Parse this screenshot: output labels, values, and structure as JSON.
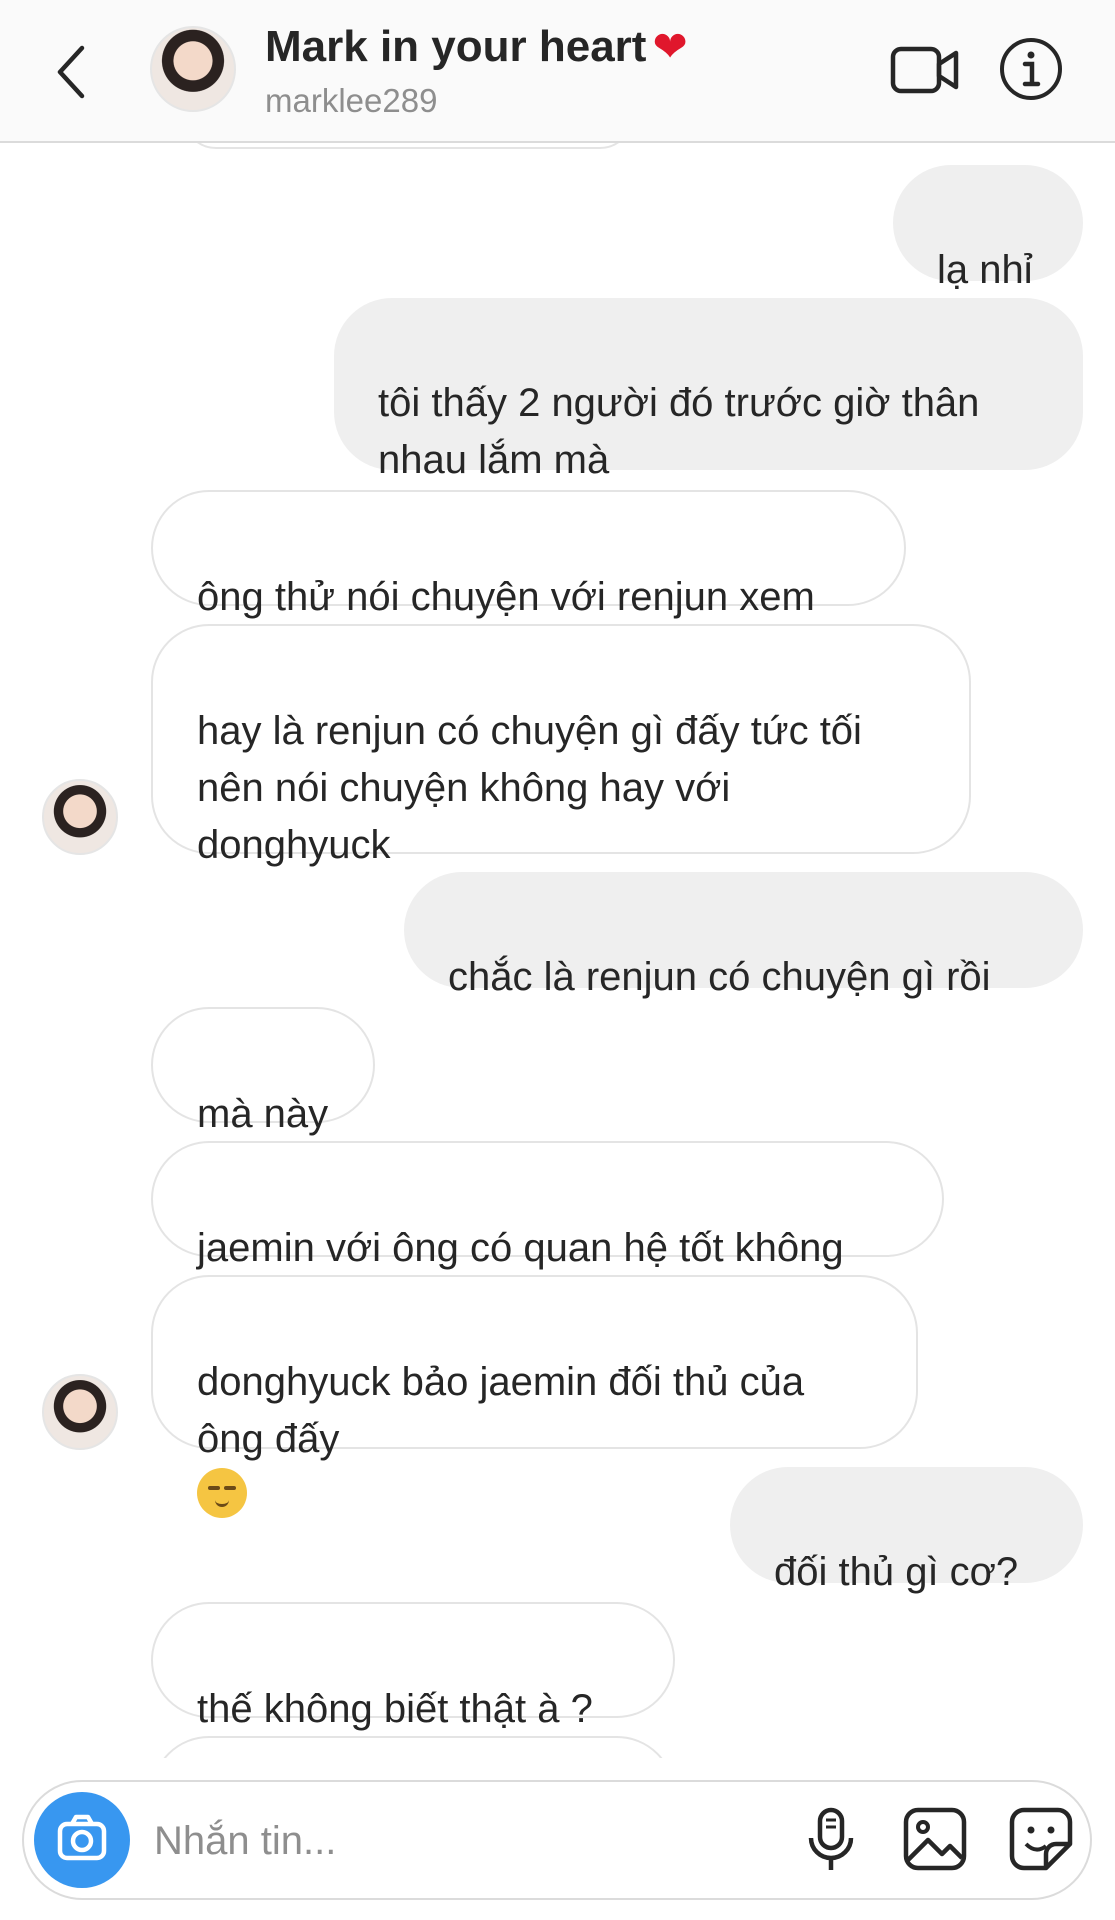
{
  "header": {
    "title": "Mark in your heart",
    "title_emoji": "❤",
    "username": "marklee289"
  },
  "messages": [
    {
      "side": "sent",
      "text": "lạ nhỉ"
    },
    {
      "side": "sent",
      "text": "tôi thấy 2 người đó trước giờ thân\nnhau lắm mà"
    },
    {
      "side": "received",
      "text": "ông thử nói chuyện với renjun xem"
    },
    {
      "side": "received",
      "text": "hay là renjun có chuyện gì đấy tức tối\nnên nói chuyện không hay với\ndonghyuck"
    },
    {
      "side": "sent",
      "text": "chắc là renjun có chuyện gì rồi"
    },
    {
      "side": "received",
      "text": "mà này"
    },
    {
      "side": "received",
      "text": "jaemin với ông có quan hệ tốt không"
    },
    {
      "side": "received",
      "text": "donghyuck bảo jaemin đối thủ của\nông đấy",
      "emoji": "relieved-face"
    },
    {
      "side": "sent",
      "text": "đối thủ gì cơ?"
    },
    {
      "side": "received",
      "text": "thế không biết thật à ?"
    }
  ],
  "composer": {
    "placeholder": "Nhắn tin..."
  },
  "colors": {
    "accent": "#3897f0",
    "heart": "#e0172c",
    "sent_bubble": "#efefef",
    "received_border": "#e4e4e4"
  }
}
